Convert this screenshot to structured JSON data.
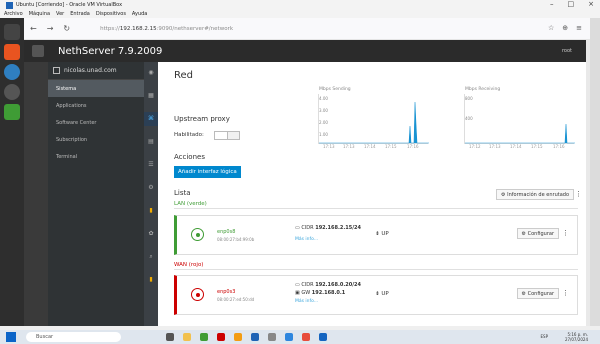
{
  "vbox": {
    "title": "Ubuntu [Corriendo] - Oracle VM VirtualBox",
    "menu": [
      "Archivo",
      "Máquina",
      "Ver",
      "Entrada",
      "Dispositivos",
      "Ayuda"
    ]
  },
  "browser": {
    "url_host": "192.168.2.15",
    "url_prefix": "https://",
    "url_rest": ":9090/nethserver#/network"
  },
  "header": {
    "brand": "NethServer 7.9.2009",
    "user": "root"
  },
  "nav": {
    "host": "nicolas.unad.com",
    "items": [
      "Sistema",
      "Applications",
      "Software Center",
      "Subscription",
      "Terminal"
    ]
  },
  "main": {
    "title": "Red",
    "upstream_proxy": "Upstream proxy",
    "enabled_label": "Habilitado:",
    "actions_label": "Acciones",
    "add_logical": "Añadir interfaz lógica",
    "list_label": "Lista",
    "routing_info": "Información de enrutado",
    "lan_label": "LAN (verde)",
    "wan_label": "WAN (rojo)"
  },
  "charts": {
    "sending": {
      "title": "Mbps  Sending",
      "y_ticks": [
        "4.00",
        "3.00",
        "2.00",
        "1.00"
      ],
      "x_ticks": [
        "17:13",
        "17:13",
        "17:14",
        "17:15",
        "17:16"
      ]
    },
    "receiving": {
      "title": "Mbps  Receiving",
      "y_ticks": [
        "800",
        "400"
      ],
      "x_ticks": [
        "17:12",
        "17:13",
        "17:14",
        "17:15",
        "17:16"
      ]
    }
  },
  "interfaces": [
    {
      "name": "enp0s8",
      "mac": "08:00:27:b4:99:0b",
      "cidr_label": "CIDR",
      "cidr": "192.168.2.15/24",
      "gw_label": "",
      "gw": "",
      "more": "Más info...",
      "state": "UP",
      "configure": "Configurar"
    },
    {
      "name": "enp0s3",
      "mac": "08:00:27:ed:50:dd",
      "cidr_label": "CIDR",
      "cidr": "192.168.0.20/24",
      "gw_label": "GW",
      "gw": "192.168.0.1",
      "more": "Más info...",
      "state": "UP",
      "configure": "Configurar"
    }
  ],
  "taskbar": {
    "search": "Buscar",
    "time": "5:16 p. m.",
    "date": "27/07/2024",
    "lang": "ESP"
  }
}
